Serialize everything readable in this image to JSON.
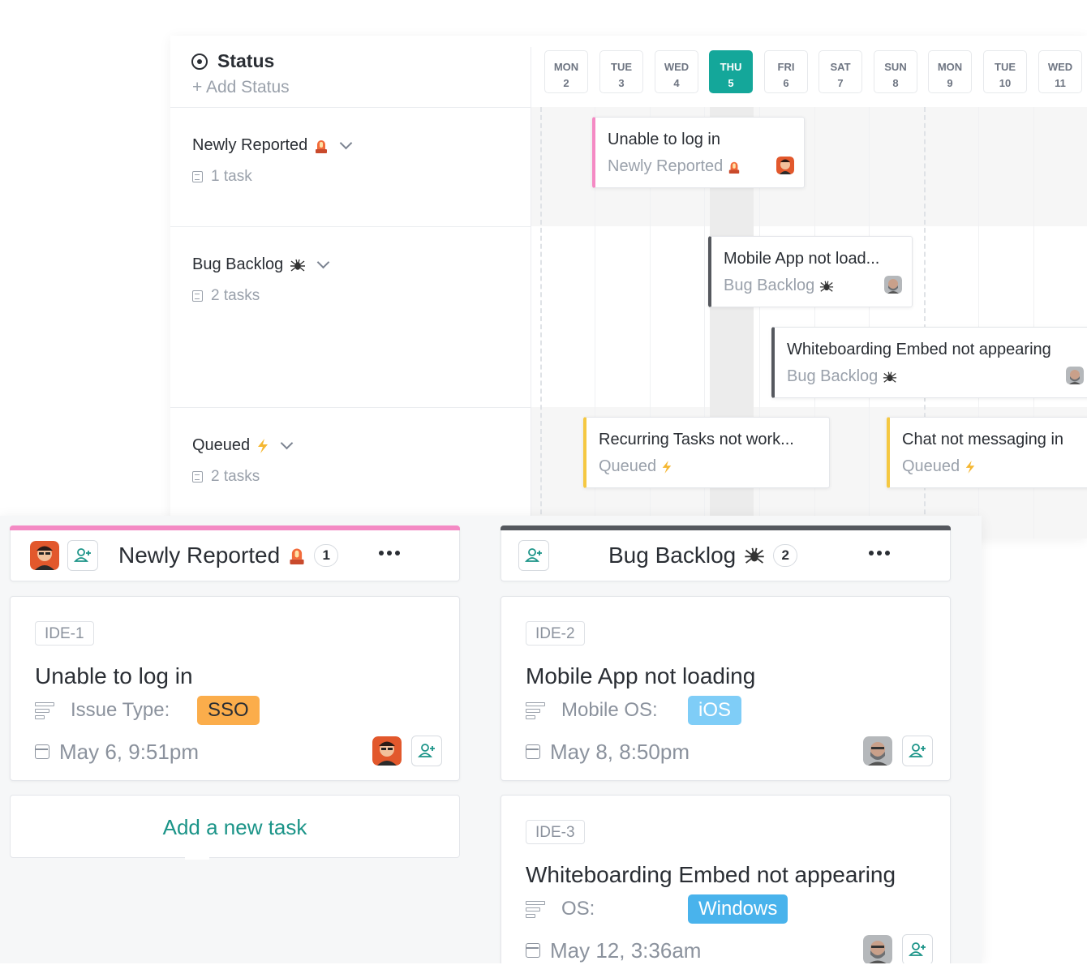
{
  "colors": {
    "accent_teal": "#14a79a",
    "newly_reported": "#f48ac4",
    "bug_backlog": "#55585e",
    "queued": "#f5c842",
    "sso_chip": "#fbad4b",
    "ios_chip": "#7fcdf7",
    "windows_chip": "#49b3ec"
  },
  "timeline": {
    "header_title": "Status",
    "add_status": "+ Add Status",
    "days": [
      {
        "dow": "MON",
        "num": "2"
      },
      {
        "dow": "TUE",
        "num": "3"
      },
      {
        "dow": "WED",
        "num": "4"
      },
      {
        "dow": "THU",
        "num": "5",
        "today": true
      },
      {
        "dow": "FRI",
        "num": "6"
      },
      {
        "dow": "SAT",
        "num": "7"
      },
      {
        "dow": "SUN",
        "num": "8"
      },
      {
        "dow": "MON",
        "num": "9"
      },
      {
        "dow": "TUE",
        "num": "10"
      },
      {
        "dow": "WED",
        "num": "11"
      }
    ],
    "groups": [
      {
        "name": "Newly Reported",
        "icon": "siren-icon",
        "count": "1 task"
      },
      {
        "name": "Bug Backlog",
        "icon": "spider-icon",
        "count": "2 tasks"
      },
      {
        "name": "Queued",
        "icon": "lightning-icon",
        "count": "2 tasks"
      }
    ],
    "bars": [
      {
        "title": "Unable to log in",
        "status": "Newly Reported",
        "icon": "siren-icon"
      },
      {
        "title": "Mobile App not load...",
        "status": "Bug Backlog",
        "icon": "spider-icon"
      },
      {
        "title": "Whiteboarding Embed not appearing",
        "status": "Bug Backlog",
        "icon": "spider-icon"
      },
      {
        "title": "Recurring Tasks not work...",
        "status": "Queued",
        "icon": "lightning-icon"
      },
      {
        "title": "Chat not messaging in",
        "status": "Queued",
        "icon": "lightning-icon"
      }
    ]
  },
  "board": {
    "columns": [
      {
        "name": "Newly Reported",
        "icon": "siren-icon",
        "count": "1"
      },
      {
        "name": "Bug Backlog",
        "icon": "spider-icon",
        "count": "2"
      }
    ],
    "cards": [
      {
        "id": "IDE-1",
        "title": "Unable to log in",
        "field_label": "Issue Type:",
        "field_value": "SSO",
        "date": "May 6, 9:51pm"
      },
      {
        "id": "IDE-2",
        "title": "Mobile App not loading",
        "field_label": "Mobile OS:",
        "field_value": "iOS",
        "date": "May 8, 8:50pm"
      },
      {
        "id": "IDE-3",
        "title": "Whiteboarding Embed not appearing",
        "field_label": "OS:",
        "field_value": "Windows",
        "date": "May 12, 3:36am"
      }
    ],
    "add_task": "Add a new task"
  }
}
